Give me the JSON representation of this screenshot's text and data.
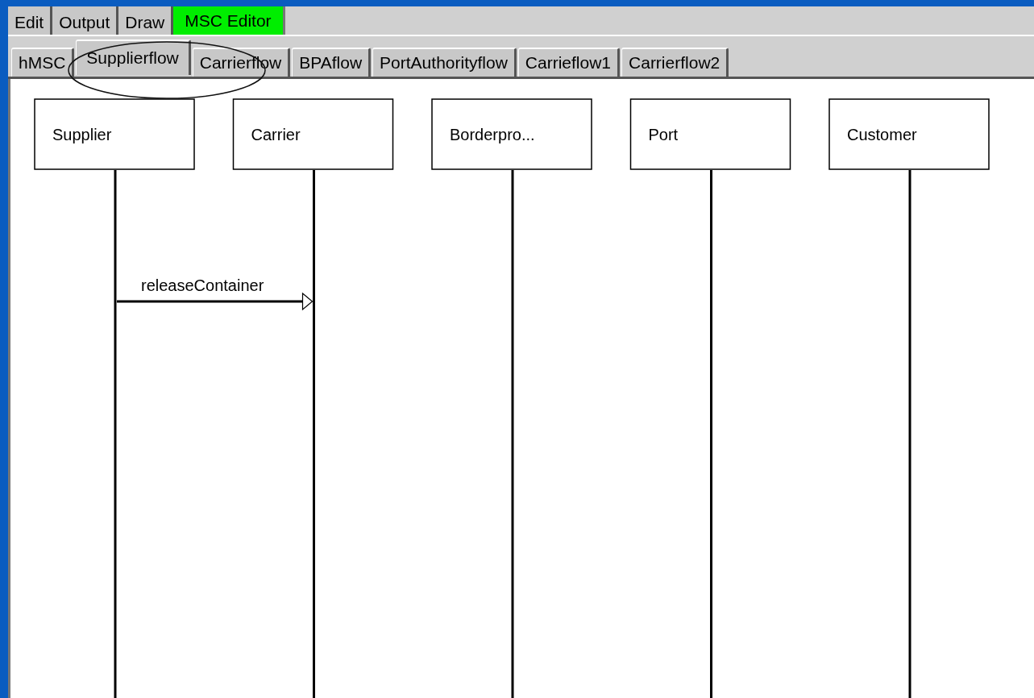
{
  "main_tabs": [
    {
      "label": "Edit",
      "selected": false
    },
    {
      "label": "Output",
      "selected": false
    },
    {
      "label": "Draw",
      "selected": false
    },
    {
      "label": "MSC Editor",
      "selected": true
    }
  ],
  "diagram_tabs": [
    {
      "label": "hMSC",
      "selected": false
    },
    {
      "label": "Supplierflow",
      "selected": true
    },
    {
      "label": "Carrierflow",
      "selected": false
    },
    {
      "label": "BPAflow",
      "selected": false
    },
    {
      "label": "PortAuthorityflow",
      "selected": false
    },
    {
      "label": "Carrieflow1",
      "selected": false
    },
    {
      "label": "Carrierflow2",
      "selected": false
    }
  ],
  "diagram": {
    "instances": [
      "Supplier",
      "Carrier",
      "Borderpro...",
      "Port",
      "Customer"
    ],
    "messages": [
      {
        "label": "releaseContainer"
      }
    ]
  }
}
